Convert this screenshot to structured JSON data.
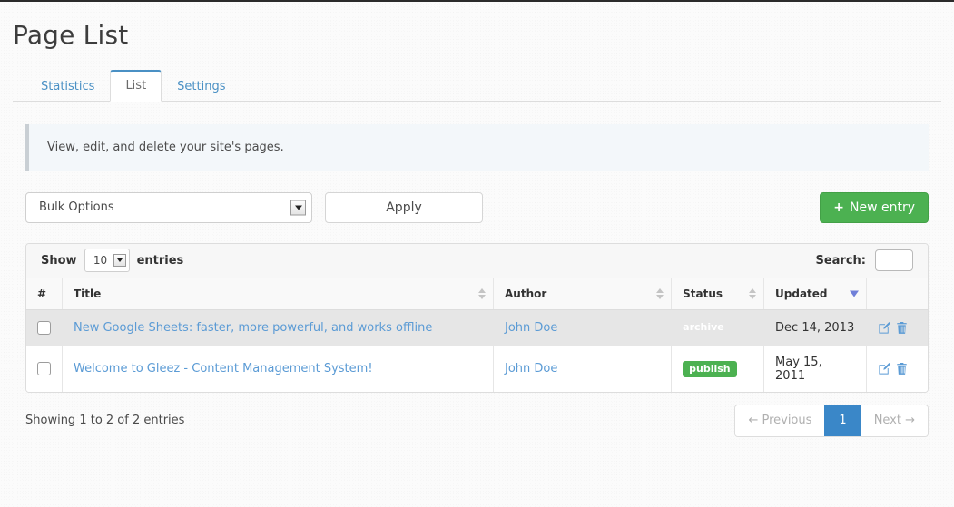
{
  "page": {
    "title": "Page List"
  },
  "tabs": [
    {
      "label": "Statistics",
      "active": false
    },
    {
      "label": "List",
      "active": true
    },
    {
      "label": "Settings",
      "active": false
    }
  ],
  "alert": {
    "text": "View, edit, and delete your site's pages."
  },
  "toolbar": {
    "bulk_select_value": "Bulk Options",
    "apply_label": "Apply",
    "new_entry_label": "New entry",
    "plus_icon": "+"
  },
  "table_controls": {
    "show_label": "Show",
    "entries_label": "entries",
    "page_length_value": "10",
    "search_label": "Search:",
    "search_value": "",
    "search_placeholder": ""
  },
  "table": {
    "columns": [
      {
        "label": "#",
        "sortable": true,
        "sort": "none"
      },
      {
        "label": "Title",
        "sortable": true,
        "sort": "none"
      },
      {
        "label": "Author",
        "sortable": true,
        "sort": "none"
      },
      {
        "label": "Status",
        "sortable": true,
        "sort": "none"
      },
      {
        "label": "Updated",
        "sortable": true,
        "sort": "desc"
      },
      {
        "label": "",
        "sortable": false,
        "sort": "none"
      }
    ],
    "rows": [
      {
        "title": "New Google Sheets: faster, more powerful, and works offline",
        "author": "John Doe",
        "status": "archive",
        "status_kind": "archive",
        "updated": "Dec 14, 2013"
      },
      {
        "title": "Welcome to Gleez - Content Management System!",
        "author": "John Doe",
        "status": "publish",
        "status_kind": "publish",
        "updated": "May 15, 2011"
      }
    ]
  },
  "footer": {
    "info": "Showing 1 to 2 of 2 entries",
    "previous_label": "← Previous",
    "page_number": "1",
    "next_label": "Next →"
  },
  "colors": {
    "accent_blue": "#3a87c8",
    "link_blue": "#5b9bd5",
    "success_green": "#4cb151",
    "sort_active": "#6f7fd8"
  }
}
